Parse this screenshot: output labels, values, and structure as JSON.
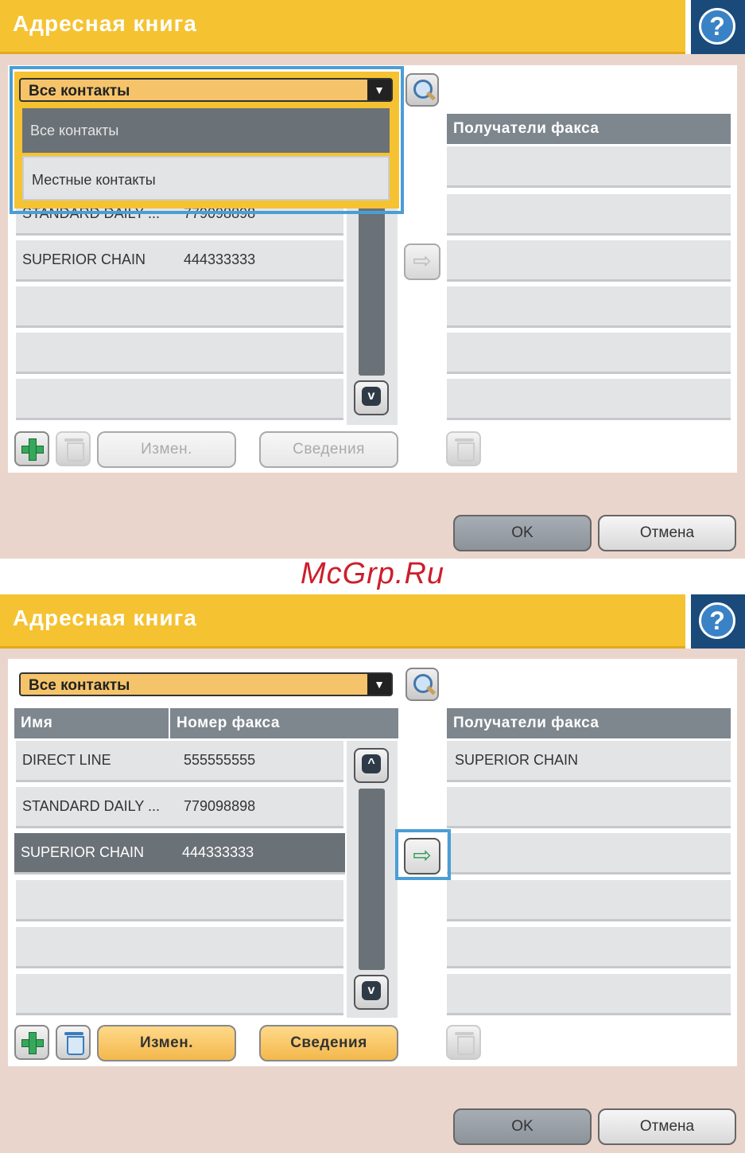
{
  "watermark": "McGrp.Ru",
  "screen1": {
    "title": "Адресная книга",
    "help_icon": "question-mark-icon",
    "dropdown_selected": "Все контакты",
    "dropdown_options": [
      "Все контакты",
      "Местные контакты"
    ],
    "rows": [
      {
        "name": "STANDARD DAILY ...",
        "number": "779098898"
      },
      {
        "name": "SUPERIOR CHAIN",
        "number": "444333333"
      }
    ],
    "recipients_header": "Получатели факса",
    "edit_label": "Измен.",
    "details_label": "Сведения",
    "ok_label": "OK",
    "cancel_label": "Отмена"
  },
  "screen2": {
    "title": "Адресная книга",
    "dropdown_selected": "Все контакты",
    "col_name": "Имя",
    "col_fax": "Номер факса",
    "rows": [
      {
        "name": "DIRECT LINE",
        "number": "555555555"
      },
      {
        "name": "STANDARD DAILY ...",
        "number": "779098898"
      },
      {
        "name": "SUPERIOR CHAIN",
        "number": "444333333"
      }
    ],
    "recipients_header": "Получатели факса",
    "recipients": [
      "SUPERIOR CHAIN"
    ],
    "edit_label": "Измен.",
    "details_label": "Сведения",
    "ok_label": "OK",
    "cancel_label": "Отмена"
  },
  "colors": {
    "title_bar": "#f5c231",
    "highlight": "#4a9ed6",
    "selected_row": "#6a7177"
  }
}
